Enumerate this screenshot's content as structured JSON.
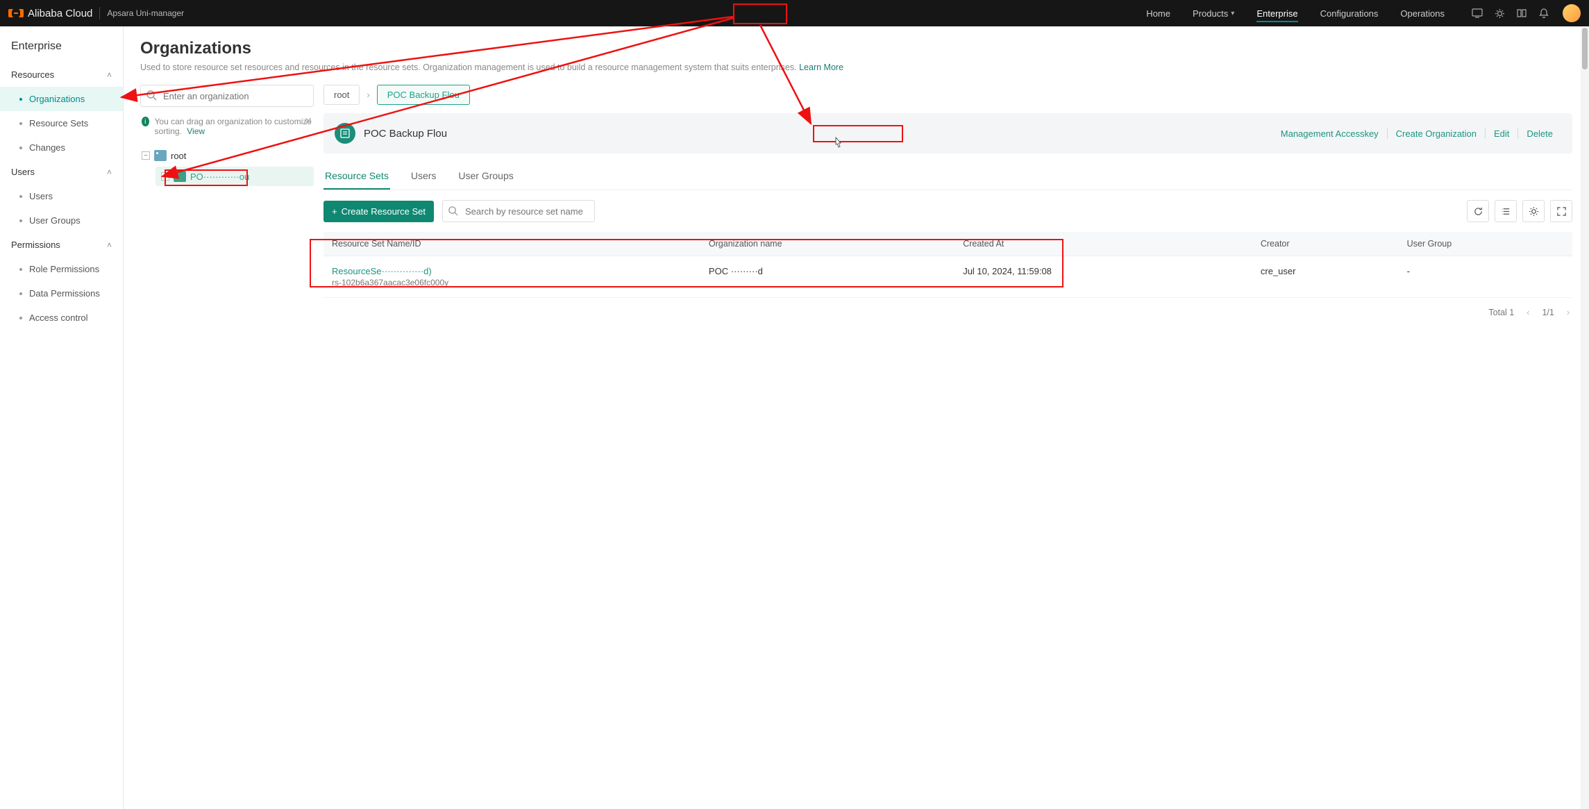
{
  "topbar": {
    "brand": "Alibaba Cloud",
    "manager": "Apsara Uni-manager",
    "nav": {
      "home": "Home",
      "products": "Products",
      "enterprise": "Enterprise",
      "configurations": "Configurations",
      "operations": "Operations"
    }
  },
  "sidebar": {
    "title": "Enterprise",
    "groups": {
      "resources": {
        "label": "Resources",
        "items": {
          "organizations": "Organizations",
          "resource_sets": "Resource Sets",
          "changes": "Changes"
        }
      },
      "users": {
        "label": "Users",
        "items": {
          "users": "Users",
          "user_groups": "User Groups"
        }
      },
      "permissions": {
        "label": "Permissions",
        "items": {
          "role_perms": "Role Permissions",
          "data_perms": "Data Permissions",
          "access_control": "Access control"
        }
      }
    }
  },
  "page": {
    "title": "Organizations",
    "desc": "Used to store resource set resources and resources in the resource sets. Organization management is used to build a resource management system that suits enterprises.",
    "learn_more": "Learn More"
  },
  "tree": {
    "search_placeholder": "Enter an organization",
    "hint_text": "You can drag an organization to customize sorting.",
    "hint_view": "View",
    "root": "root",
    "child": "PO············ou"
  },
  "breadcrumbs": {
    "root": "root",
    "child": "POC Backup Flou"
  },
  "org": {
    "name": "POC Backup Flou",
    "actions": {
      "accesskey": "Management Accesskey",
      "create": "Create Organization",
      "edit": "Edit",
      "delete": "Delete"
    }
  },
  "tabs": {
    "rs": "Resource Sets",
    "users": "Users",
    "ug": "User Groups"
  },
  "toolbar": {
    "create_rs": "Create Resource Set",
    "search_placeholder": "Search by resource set name"
  },
  "table": {
    "headers": {
      "name": "Resource Set Name/ID",
      "org": "Organization name",
      "created": "Created At",
      "creator": "Creator",
      "ug": "User Group"
    },
    "rows": [
      {
        "name": "ResourceSe··············d)",
        "id": "rs-102b6a367aacac3e06fc000y",
        "org": "POC ·········d",
        "created": "Jul 10, 2024, 11:59:08",
        "creator": "cre_user",
        "ug": "-"
      }
    ]
  },
  "pager": {
    "total": "Total 1",
    "page": "1/1"
  }
}
